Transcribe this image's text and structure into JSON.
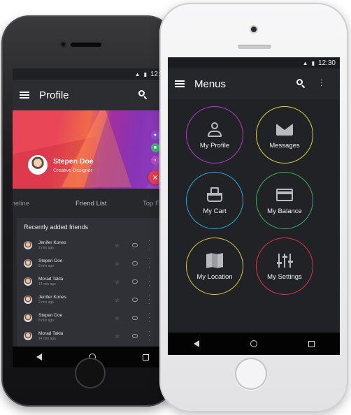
{
  "back_phone": {
    "status_bar": {
      "time": "12:30"
    },
    "app_bar": {
      "title": "Profile"
    },
    "profile": {
      "name": "Stepen Doe",
      "role": "Creative Designer"
    },
    "tabs": {
      "left": "meline",
      "center": "Friend List",
      "right": "Top F"
    },
    "friends_section_title": "Recently added friends",
    "friends": [
      {
        "name": "Jenifer Kones",
        "time": "2 min ago"
      },
      {
        "name": "Stepen Doe",
        "time": "8 min ago"
      },
      {
        "name": "Morad Takla",
        "time": "14 min ago"
      },
      {
        "name": "Jenifer Kones",
        "time": "2 min ago"
      },
      {
        "name": "Stepen Doe",
        "time": "8 min ago"
      },
      {
        "name": "Morad Takla",
        "time": "14 min ago"
      }
    ]
  },
  "front_phone": {
    "status_bar": {
      "time": "12:30"
    },
    "app_bar": {
      "title": "Menus"
    },
    "menu_items": [
      {
        "label": "My Profile",
        "icon": "person-icon",
        "ring_color": "#b03fc4"
      },
      {
        "label": "Messages",
        "icon": "mail-icon",
        "ring_color": "#d9d83a"
      },
      {
        "label": "My Cart",
        "icon": "basket-icon",
        "ring_color": "#2aa7d6"
      },
      {
        "label": "My Balance",
        "icon": "card-icon",
        "ring_color": "#35b25d"
      },
      {
        "label": "My Location",
        "icon": "map-icon",
        "ring_color": "#d8c83a"
      },
      {
        "label": "My Settings",
        "icon": "sliders-icon",
        "ring_color": "#e0334b"
      }
    ]
  },
  "colors": {
    "accent_red": "#e63b4c",
    "screen_dark": "#202226"
  }
}
